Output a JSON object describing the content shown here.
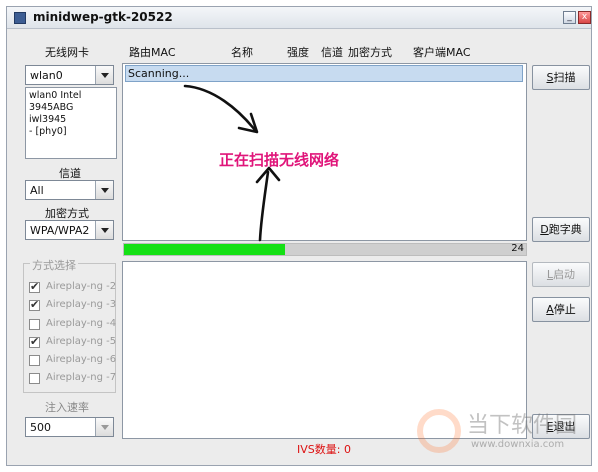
{
  "window": {
    "title": "minidwep-gtk-20522",
    "min_glyph": "_",
    "close_glyph": "x"
  },
  "left": {
    "nic_label": "无线网卡",
    "nic_value": "wlan0",
    "nic_info_lines": [
      "wlan0 Intel",
      "3945ABG iwl3945",
      "- [phy0]"
    ],
    "channel_label": "信道",
    "channel_value": "All",
    "enc_label": "加密方式",
    "enc_value": "WPA/WPA2",
    "mode_group_title": "方式选择",
    "modes": [
      {
        "label": "Aireplay-ng -2",
        "checked": true
      },
      {
        "label": "Aireplay-ng -3",
        "checked": true
      },
      {
        "label": "Aireplay-ng -4",
        "checked": false
      },
      {
        "label": "Aireplay-ng -5",
        "checked": true
      },
      {
        "label": "Aireplay-ng -6",
        "checked": false
      },
      {
        "label": "Aireplay-ng -7",
        "checked": false
      }
    ],
    "rate_label": "注入速率",
    "rate_value": "500"
  },
  "table": {
    "columns": [
      "路由MAC",
      "名称",
      "强度",
      "信道",
      "加密方式",
      "客户端MAC"
    ],
    "status_row": "Scanning..."
  },
  "annotation": "正在扫描无线网络",
  "progress": {
    "fraction": 0.4,
    "value_text": "24",
    "color": "#14e014"
  },
  "buttons": {
    "scan": {
      "key": "S",
      "text": "扫描"
    },
    "dict": {
      "key": "D",
      "text": "跑字典"
    },
    "start": {
      "key": "L",
      "text": "启动"
    },
    "stop": {
      "key": "A",
      "text": "停止"
    },
    "exit": {
      "key": "E",
      "text": "退出"
    }
  },
  "status": {
    "ivs": "IVS数量: 0"
  },
  "watermark": {
    "text": "当下软件园",
    "url": "www.downxia.com"
  },
  "colors": {
    "accent_annotation": "#e0157a",
    "ivs_text": "#dd1111",
    "selected_row": "#c7dbf0"
  }
}
